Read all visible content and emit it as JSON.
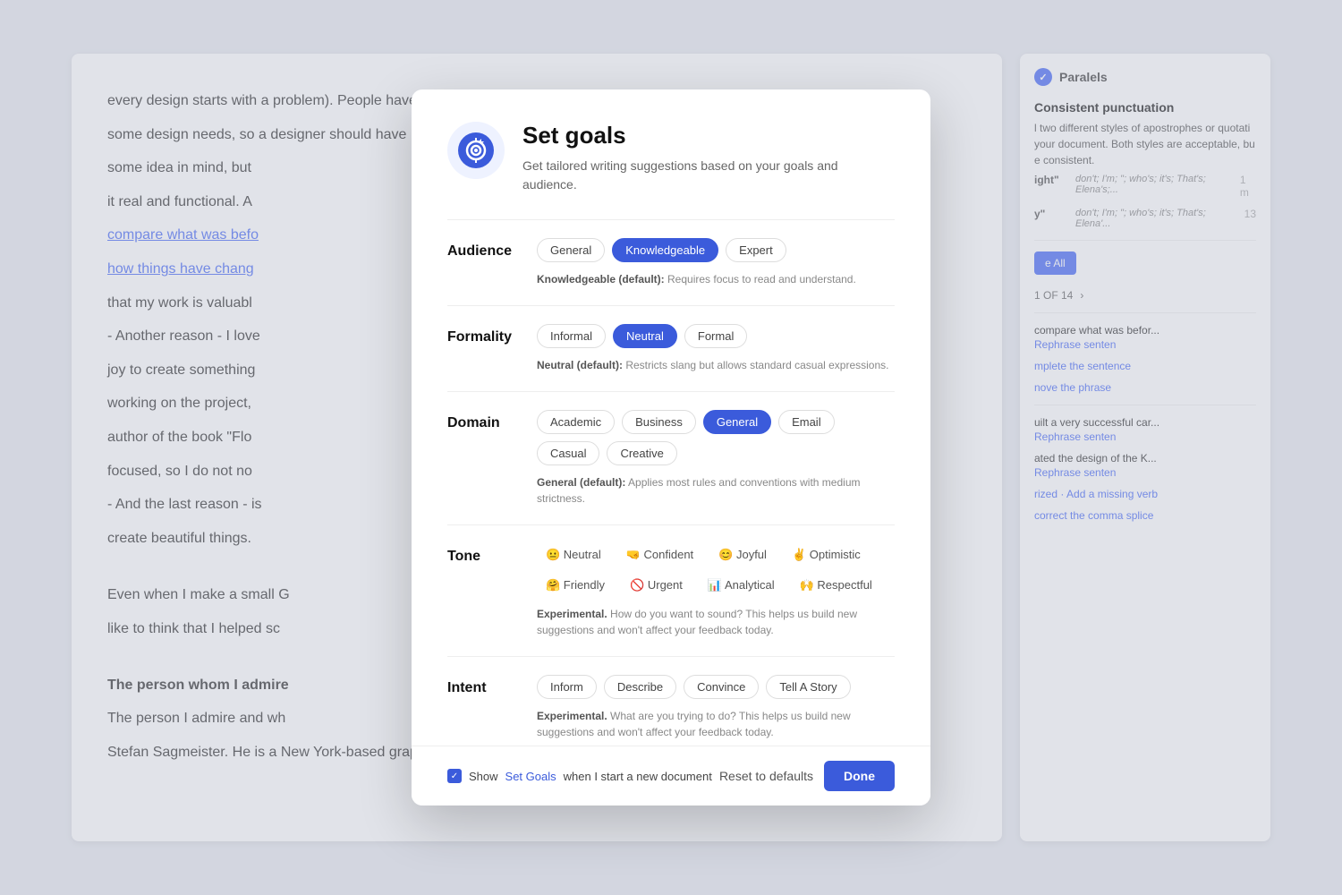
{
  "modal": {
    "title": "Set goals",
    "subtitle": "Get tailored writing suggestions based on your goals and audience.",
    "audience": {
      "label": "Audience",
      "options": [
        {
          "id": "general",
          "label": "General",
          "active": false
        },
        {
          "id": "knowledgeable",
          "label": "Knowledgeable",
          "active": true
        },
        {
          "id": "expert",
          "label": "Expert",
          "active": false
        }
      ],
      "desc_label": "Knowledgeable (default):",
      "desc_text": "Requires focus to read and understand."
    },
    "formality": {
      "label": "Formality",
      "options": [
        {
          "id": "informal",
          "label": "Informal",
          "active": false
        },
        {
          "id": "neutral",
          "label": "Neutral",
          "active": true
        },
        {
          "id": "formal",
          "label": "Formal",
          "active": false
        }
      ],
      "desc_label": "Neutral (default):",
      "desc_text": "Restricts slang but allows standard casual expressions."
    },
    "domain": {
      "label": "Domain",
      "options": [
        {
          "id": "academic",
          "label": "Academic",
          "active": false
        },
        {
          "id": "business",
          "label": "Business",
          "active": false
        },
        {
          "id": "general",
          "label": "General",
          "active": true
        },
        {
          "id": "email",
          "label": "Email",
          "active": false
        },
        {
          "id": "casual",
          "label": "Casual",
          "active": false
        },
        {
          "id": "creative",
          "label": "Creative",
          "active": false
        }
      ],
      "desc_label": "General (default):",
      "desc_text": "Applies most rules and conventions with medium strictness."
    },
    "tone": {
      "label": "Tone",
      "options": [
        {
          "id": "neutral",
          "label": "Neutral",
          "emoji": "😐",
          "active": false
        },
        {
          "id": "confident",
          "label": "Confident",
          "emoji": "🤜",
          "active": false
        },
        {
          "id": "joyful",
          "label": "Joyful",
          "emoji": "😊",
          "active": false
        },
        {
          "id": "optimistic",
          "label": "Optimistic",
          "emoji": "✌️",
          "active": false
        },
        {
          "id": "friendly",
          "label": "Friendly",
          "emoji": "🤗",
          "active": false
        },
        {
          "id": "urgent",
          "label": "Urgent",
          "emoji": "🚫",
          "active": false
        },
        {
          "id": "analytical",
          "label": "Analytical",
          "emoji": "📊",
          "active": false
        },
        {
          "id": "respectful",
          "label": "Respectful",
          "emoji": "🙌",
          "active": false
        }
      ],
      "experimental_label": "Experimental.",
      "desc_text": "How do you want to sound? This helps us build new suggestions and won't affect your feedback today."
    },
    "intent": {
      "label": "Intent",
      "options": [
        {
          "id": "inform",
          "label": "Inform",
          "active": false
        },
        {
          "id": "describe",
          "label": "Describe",
          "active": false
        },
        {
          "id": "convince",
          "label": "Convince",
          "active": false
        },
        {
          "id": "tell-a-story",
          "label": "Tell A Story",
          "active": false
        }
      ],
      "experimental_label": "Experimental.",
      "desc_text": "What are you trying to do? This helps us build new suggestions and won't affect your feedback today."
    },
    "footer": {
      "checkbox_label": "Show",
      "set_goals_text": "Set Goals",
      "when_text": "when I start a new document",
      "reset_label": "Reset to defaults",
      "done_label": "Done"
    }
  },
  "background": {
    "doc_text_1": "every design starts with a problem). People have",
    "doc_text_2": "some design needs, so a designer should have",
    "doc_text_3": "some idea in mind, but",
    "doc_text_4": "it real and functional. A",
    "doc_text_5": "compare what was befo",
    "doc_text_6": "how things have chang",
    "doc_text_7": "that my work is valuabl",
    "doc_text_8": "- Another reason - I love",
    "doc_text_9": "joy to create something",
    "doc_text_10": "working on the project,",
    "doc_text_11": "author of the book \"Flo",
    "doc_text_12": "focused, so I do not no",
    "doc_text_13": "- And the last reason - is",
    "doc_text_14": "create beautiful things.",
    "doc_text_15": "Even when I make a small G",
    "doc_text_16": "like to think that I helped sc",
    "doc_heading": "The person whom I admire",
    "doc_text_17": "The person I admire and wh",
    "doc_text_18": "Stefan Sagmeister. He is a New York-based graphic",
    "sidebar_title": "Paralels",
    "sidebar_section": "Consistent punctuation",
    "sidebar_desc": "l two different styles of apostrophes or quotati",
    "sidebar_desc2": "your document. Both styles are acceptable, bu",
    "sidebar_desc3": "e consistent.",
    "sidebar_quote1": "ight\"",
    "sidebar_quote1_text": "don't; I'm; \"; who's; it's; That's; Elena's;...",
    "sidebar_quote1_count": "1 m",
    "sidebar_quote2": "y\"",
    "sidebar_quote2_text": "don't; I'm; \"; who's; it's; That's; Elena'...",
    "sidebar_quote2_count": "13",
    "accept_all": "e All",
    "pagination": "1 OF 14",
    "rephrase1_text": "compare what was befor...",
    "rephrase1_action": "Rephrase senten",
    "rephrase2_action": "mplete the sentence",
    "rephrase3_action": "nove the phrase",
    "rephrase4_text": "uilt a very successful car...",
    "rephrase4_action": "Rephrase senten",
    "rephrase5_text": "ated the design of the K...",
    "rephrase5_action": "Rephrase senten",
    "rephrase6_action": "rized · Add a missing verb",
    "rephrase7_action": "correct the comma splice"
  }
}
